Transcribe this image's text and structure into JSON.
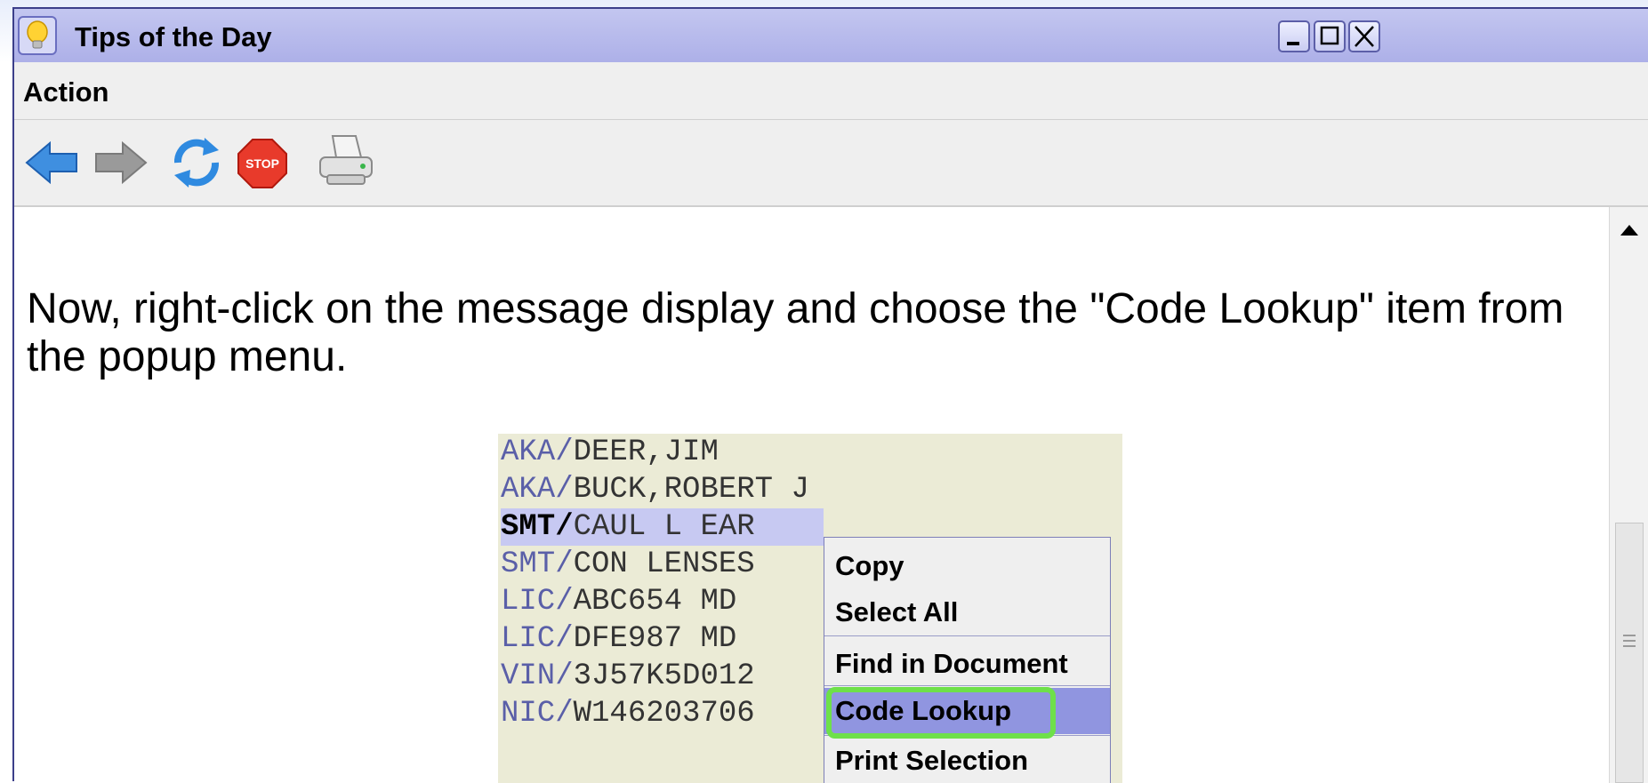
{
  "window": {
    "title": "Tips of the Day",
    "menu": [
      {
        "label": "Action"
      }
    ],
    "toolbar": {
      "back": "back-arrow-icon",
      "forward": "forward-arrow-icon",
      "refresh": "refresh-icon",
      "stop": "STOP",
      "print": "printer-icon"
    }
  },
  "content": {
    "tip_text": "Now, right-click on the message display and choose the \"Code Lookup\" item from the popup menu.",
    "image_lines": [
      {
        "tag": "AKA/",
        "value": "DEER,JIM"
      },
      {
        "tag": "AKA/",
        "value": "BUCK,ROBERT J"
      },
      {
        "tag": "SMT/",
        "value": "CAUL L EAR"
      },
      {
        "tag": "SMT/",
        "value": "CON LENSES"
      },
      {
        "tag": "LIC/",
        "value": "ABC654 MD"
      },
      {
        "tag": "LIC/",
        "value": "DFE987 MD"
      },
      {
        "tag": "VIN/",
        "value": "3J57K5D012"
      },
      {
        "tag": "NIC/",
        "value": "W146203706"
      }
    ],
    "popup_menu": [
      "Copy",
      "Select All",
      "Find in Document",
      "Code Lookup",
      "Print Selection"
    ],
    "highlight_color": "#6ee04a",
    "selection_color": "#9095e0"
  }
}
